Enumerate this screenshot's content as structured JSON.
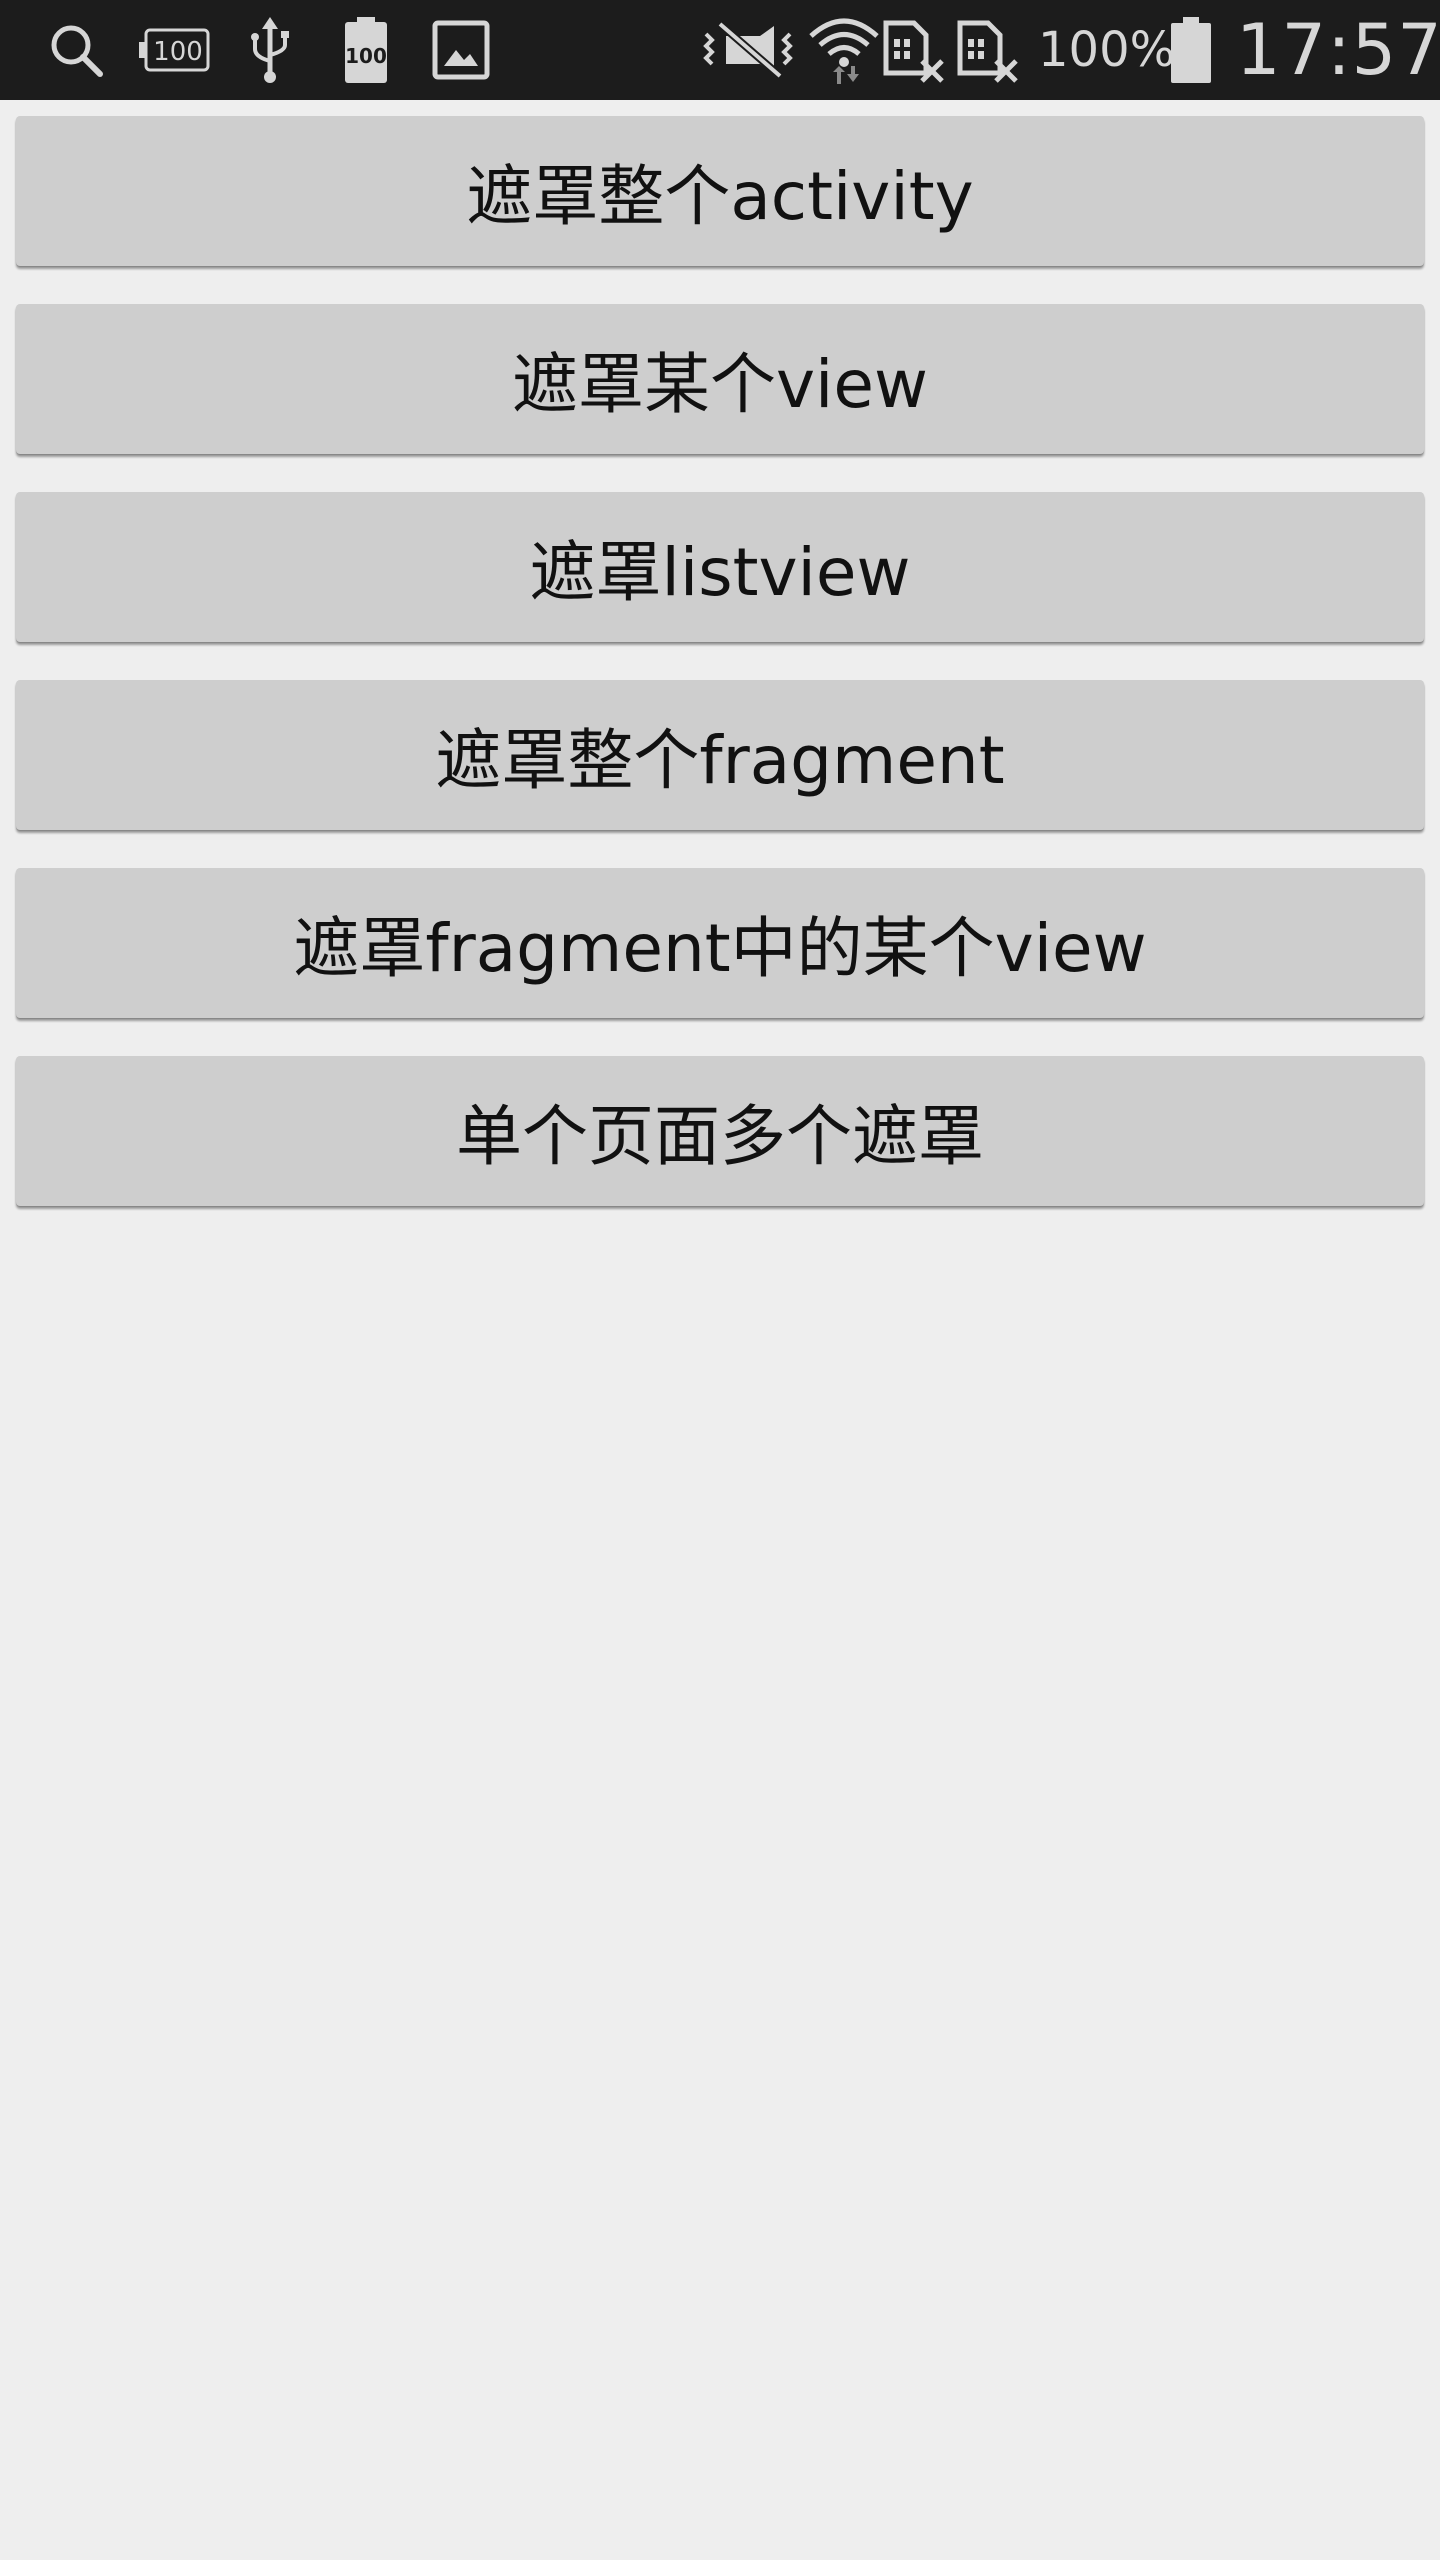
{
  "status_bar": {
    "icons_left": [
      "search-icon",
      "battery-100-icon",
      "usb-icon",
      "battery-alt-100-icon",
      "image-icon"
    ],
    "battery_box_label": "100",
    "battery_alt_label": "100",
    "icons_right": [
      "vibrate-mute-icon",
      "wifi-icon",
      "sim1-no-signal-icon",
      "sim2-no-signal-icon",
      "battery-icon"
    ],
    "battery_percent": "100%",
    "time": "17:57",
    "colors": {
      "background": "#1c1c1c",
      "foreground": "#d6d6d6"
    }
  },
  "buttons": [
    {
      "label": "遮罩整个activity"
    },
    {
      "label": "遮罩某个view"
    },
    {
      "label": "遮罩listview"
    },
    {
      "label": "遮罩整个fragment"
    },
    {
      "label": "遮罩fragment中的某个view"
    },
    {
      "label": "单个页面多个遮罩"
    }
  ],
  "colors": {
    "page_background": "#eeeeee",
    "button_background": "#cecece",
    "button_text": "#111111"
  }
}
